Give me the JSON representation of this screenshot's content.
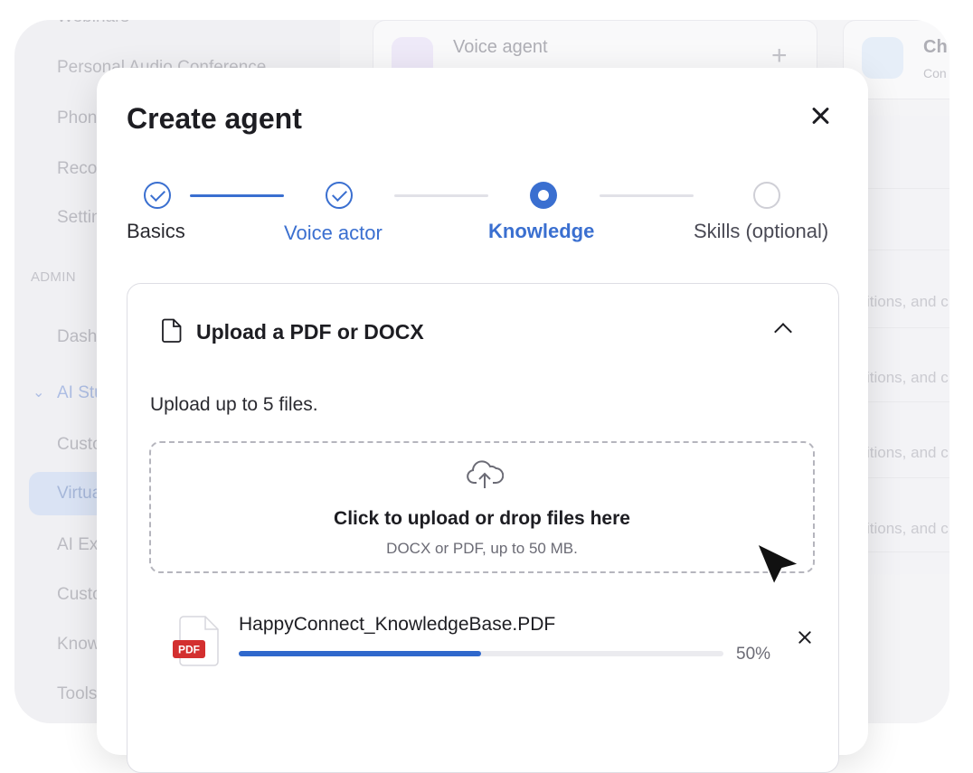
{
  "background": {
    "sidebar": {
      "items": [
        "Webinars",
        "Personal Audio Conference",
        "Phone",
        "Recordings",
        "Settings"
      ],
      "section_label": "ADMIN",
      "admin_items": [
        "Dashboard",
        "AI Studio",
        "Custom",
        "Virtual",
        "AI Expert",
        "Custom",
        "Knowledge",
        "Tools"
      ]
    },
    "cards": [
      {
        "title": "Voice agent"
      },
      {
        "title": "Ch",
        "subtitle": "Con"
      }
    ],
    "row_text": "itions, and c"
  },
  "modal": {
    "title": "Create agent",
    "steps": [
      {
        "label": "Basics",
        "state": "done"
      },
      {
        "label": "Voice actor",
        "state": "done"
      },
      {
        "label": "Knowledge",
        "state": "active"
      },
      {
        "label": "Skills (optional)",
        "state": "todo"
      }
    ],
    "upload": {
      "title": "Upload a PDF or DOCX",
      "hint": "Upload up to 5 files.",
      "drop_title": "Click to upload or drop files here",
      "drop_sub": "DOCX or PDF, up to 50 MB.",
      "file": {
        "badge": "PDF",
        "name": "HappyConnect_KnowledgeBase.PDF",
        "progress_label": "50%",
        "progress": 0.5
      }
    }
  },
  "colors": {
    "accent": "#3a6fd0",
    "progress": "#2f68cc",
    "pdf_badge": "#d32f2f"
  }
}
